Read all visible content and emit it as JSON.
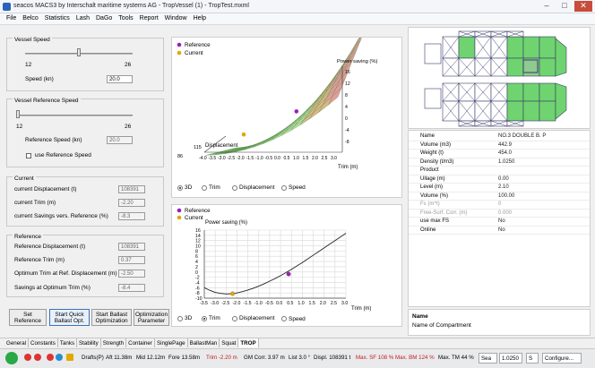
{
  "window": {
    "title": "seacos MACS3 by Interschalt maritime systems AG - TropVessel (1) - TropTest.mxml",
    "min": "–",
    "max": "□",
    "close": "✕"
  },
  "menu": [
    "File",
    "Belco",
    "Statistics",
    "Lash",
    "DaGo",
    "Tools",
    "Report",
    "Window",
    "Help"
  ],
  "vessel_speed": {
    "title": "Vessel Speed",
    "min": "12",
    "max": "26",
    "level": 0.5,
    "speed_label": "Speed (kn)",
    "speed_value": "20.0"
  },
  "vessel_reference_speed": {
    "title": "Vessel Reference Speed",
    "min": "12",
    "max": "26",
    "level": 0.0,
    "ref_label": "Reference Speed (kn)",
    "ref_value": "20.0",
    "use_ref_label": "use Reference Speed"
  },
  "current": {
    "title": "Current",
    "rows": [
      {
        "label": "current Displacement (t)",
        "value": "108391"
      },
      {
        "label": "current Trim (m)",
        "value": "-2.20"
      },
      {
        "label": "current Savings vers. Reference (%)",
        "value": "-8.3"
      }
    ]
  },
  "reference": {
    "title": "Reference",
    "rows": [
      {
        "label": "Reference Displacement (t)",
        "value": "108391"
      },
      {
        "label": "Reference Trim (m)",
        "value": "0.37"
      },
      {
        "label": "Optimum Trim at Ref. Displacement (m)",
        "value": "-2.50"
      },
      {
        "label": "Savings at Optimum Trim (%)",
        "value": "-8.4"
      }
    ]
  },
  "buttons": {
    "set_reference": [
      "Set",
      "Reference"
    ],
    "start_quick": [
      "Start Quick",
      "Ballast Opt."
    ],
    "start_ballast": [
      "Start Ballast",
      "Optimization"
    ],
    "opt_param": [
      "Optimization",
      "Parameter"
    ]
  },
  "chart3d": {
    "legend_reference": "Reference",
    "legend_current": "Current",
    "zlabel": "Power saving (%)",
    "xlabel": "Trim (m)",
    "ylabel": "Displacement",
    "y_tick_top": "115",
    "y_tick_bottom": "86",
    "x_ticks": [
      "-4.0",
      "-3.5",
      "-3.0",
      "-2.5",
      "-2.0",
      "-1.5",
      "-1.0",
      "-0.5",
      "0.0",
      "0.5",
      "1.0",
      "1.5",
      "2.0",
      "2.5",
      "3.0"
    ],
    "z_ticks": [
      "16",
      "12",
      "8",
      "4",
      "0",
      "-4",
      "-8"
    ],
    "radios": [
      "3D",
      "Trim",
      "Displacement",
      "Speed"
    ],
    "selected": "3D"
  },
  "chart_data": {
    "type": "line",
    "title": "Power saving (%)",
    "xlabel": "Trim (m)",
    "ylabel": "",
    "xlim": [
      -3.5,
      3.0
    ],
    "ylim": [
      -10,
      16
    ],
    "x_ticks": [
      "-3.5",
      "-3.0",
      "-2.5",
      "-2.0",
      "-1.5",
      "-1.0",
      "-0.5",
      "0.0",
      "0.5",
      "1.0",
      "1.5",
      "2.0",
      "2.5",
      "3.0"
    ],
    "y_ticks": [
      "16",
      "14",
      "12",
      "10",
      "8",
      "6",
      "4",
      "2",
      "0",
      "-2",
      "-4",
      "-6",
      "-8",
      "-10"
    ],
    "x": [
      -3.5,
      -3.25,
      -3.0,
      -2.75,
      -2.5,
      -2.25,
      -2.0,
      -1.75,
      -1.5,
      -1.25,
      -1.0,
      -0.75,
      -0.5,
      -0.25,
      0.0,
      0.25,
      0.5,
      0.75,
      1.0,
      1.25,
      1.5,
      1.75,
      2.0,
      2.25,
      2.5,
      2.75,
      3.0
    ],
    "y": [
      -6.0,
      -7.0,
      -7.8,
      -8.2,
      -8.4,
      -8.3,
      -8.0,
      -7.5,
      -6.9,
      -6.2,
      -5.4,
      -4.5,
      -3.5,
      -2.5,
      -1.4,
      -0.2,
      1.0,
      2.3,
      3.6,
      5.0,
      6.4,
      7.8,
      9.2,
      10.6,
      12.0,
      13.4,
      14.8
    ],
    "series": [
      {
        "name": "Reference",
        "x": 0.37,
        "y": -0.8,
        "color": "#9b1fb8"
      },
      {
        "name": "Current",
        "x": -2.2,
        "y": -8.3,
        "color": "#e0a800"
      }
    ],
    "grid": true,
    "legend": "top-left",
    "radios": [
      "3D",
      "Trim",
      "Displacement",
      "Speed"
    ],
    "selected": "Trim"
  },
  "properties": [
    {
      "key": "Name",
      "value": "NO.3 DOUBLE B. P",
      "grey": false
    },
    {
      "key": "Volume (m3)",
      "value": "442.9",
      "grey": false
    },
    {
      "key": "Weight (t)",
      "value": "454.0",
      "grey": false
    },
    {
      "key": "Density (t/m3)",
      "value": "1.0250",
      "grey": false
    },
    {
      "key": "Product",
      "value": "",
      "grey": false
    },
    {
      "key": "Ullage (m)",
      "value": "0.00",
      "grey": false
    },
    {
      "key": "Level (m)",
      "value": "2.10",
      "grey": false
    },
    {
      "key": "Volume (%)",
      "value": "100.00",
      "grey": false
    },
    {
      "key": "Fs (m^t)",
      "value": "0",
      "grey": true
    },
    {
      "key": "Free-Surf. Corr. (m)",
      "value": "0.000",
      "grey": true
    },
    {
      "key": "use max FS",
      "value": "No",
      "grey": false
    },
    {
      "key": "Online",
      "value": "No",
      "grey": false
    }
  ],
  "namebox": {
    "title": "Name",
    "desc": "Name of Compartment"
  },
  "tabs": [
    "General",
    "Constants",
    "Tanks",
    "Stability",
    "Strength",
    "Container",
    "SinglePage",
    "BallastMan",
    "Squat",
    "TROP"
  ],
  "active_tab": "TROP",
  "status": {
    "drafts": "Drafts(P)",
    "aft": "Aft 11.38m",
    "mid": "Mid 12.12m",
    "fore": "Fore 13.58m",
    "trim": "Trim -2.20 m",
    "gm": "GM Corr. 3.97 m",
    "list": "List 3.0 °",
    "displ": "Displ. 108391 t",
    "max_sf": "Max. SF 108 %",
    "max_bm": "Max. BM 124 %",
    "max_tm": "Max. TM 44 %",
    "sea": "Sea",
    "density": "1.0250",
    "s": "S",
    "configure": "Configure..."
  }
}
